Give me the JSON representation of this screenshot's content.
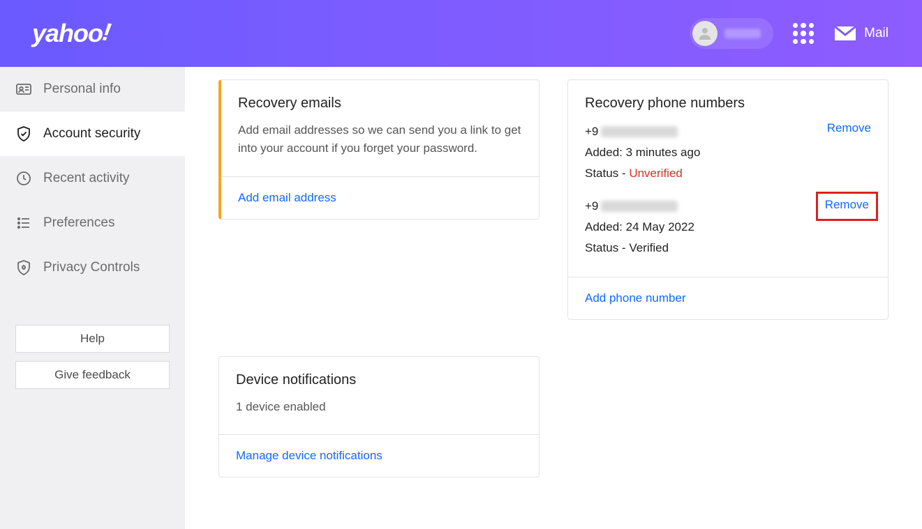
{
  "header": {
    "logo": "yahoo!",
    "mail_label": "Mail"
  },
  "sidebar": {
    "items": [
      {
        "label": "Personal info"
      },
      {
        "label": "Account security"
      },
      {
        "label": "Recent activity"
      },
      {
        "label": "Preferences"
      },
      {
        "label": "Privacy Controls"
      }
    ],
    "help_label": "Help",
    "feedback_label": "Give feedback"
  },
  "recovery_emails": {
    "title": "Recovery emails",
    "desc": "Add email addresses so we can send you a link to get into your account if you forget your password.",
    "action": "Add email address"
  },
  "device_notifications": {
    "title": "Device notifications",
    "status": "1 device enabled",
    "action": "Manage device notifications"
  },
  "recovery_phones": {
    "title": "Recovery phone numbers",
    "entries": [
      {
        "prefix": "+9",
        "added_label": "Added:",
        "added_value": "3 minutes ago",
        "status_label": "Status -",
        "status_value": "Unverified",
        "status_class": "unverified",
        "remove": "Remove"
      },
      {
        "prefix": "+9",
        "added_label": "Added:",
        "added_value": "24 May 2022",
        "status_label": "Status -",
        "status_value": "Verified",
        "status_class": "",
        "remove": "Remove"
      }
    ],
    "action": "Add phone number"
  }
}
